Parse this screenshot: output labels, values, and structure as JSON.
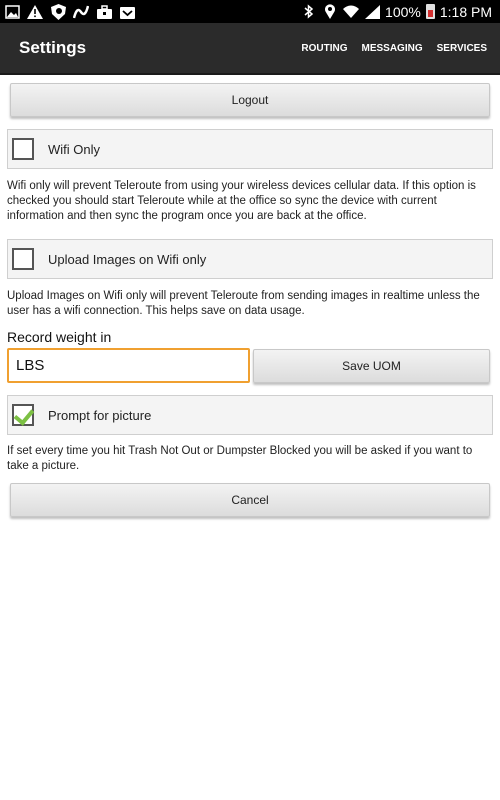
{
  "status_bar": {
    "left_icons": [
      "image-icon",
      "warning-icon",
      "shield-icon",
      "route-icon",
      "briefcase-icon",
      "inbox-icon"
    ],
    "right_icons": [
      "bluetooth-icon",
      "location-icon",
      "wifi-icon",
      "signal-icon"
    ],
    "battery": "100%",
    "time": "1:18 PM"
  },
  "header": {
    "title": "Settings",
    "menu": [
      "ROUTING",
      "MESSAGING",
      "SERVICES"
    ]
  },
  "buttons": {
    "logout": "Logout",
    "save_uom": "Save UOM",
    "cancel": "Cancel"
  },
  "settings": {
    "wifi_only": {
      "label": "Wifi Only",
      "checked": false,
      "help": "Wifi only will prevent Teleroute from using your wireless devices cellular data. If this option is checked you should start Teleroute while at the office so sync the device with current information and then sync the program once you are back at the office."
    },
    "upload_images": {
      "label": "Upload Images on Wifi only",
      "checked": false,
      "help": "Upload Images on Wifi only will prevent Teleroute from sending images in realtime unless the user has a wifi connection. This helps save on data usage."
    },
    "record_weight": {
      "label": "Record weight in",
      "value": "LBS"
    },
    "prompt_picture": {
      "label": "Prompt for picture",
      "checked": true,
      "help": "If set every time you hit Trash Not Out or Dumpster Blocked you will be asked if you want to take a picture."
    }
  },
  "colors": {
    "action_bar": "#2b2b2b",
    "input_focus": "#f0a030",
    "check_tick": "#7cc043"
  }
}
